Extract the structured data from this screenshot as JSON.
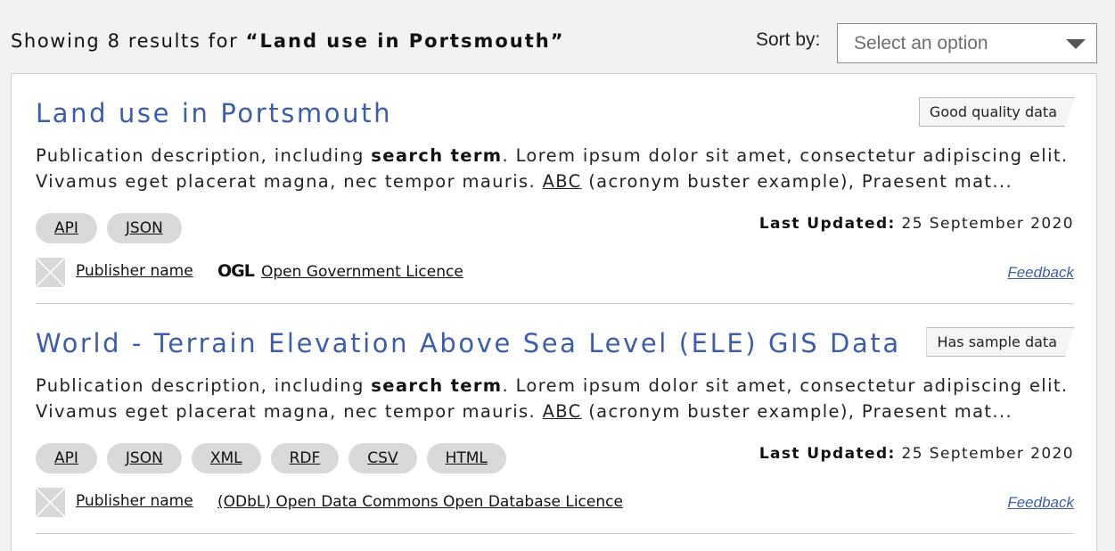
{
  "header": {
    "results_prefix": "Showing 8 results for ",
    "search_term": "“Land use in Portsmouth”",
    "sort_label": "Sort by:",
    "sort_placeholder": "Select an option"
  },
  "results": [
    {
      "title": "Land use in Portsmouth",
      "quality_badge": "Good quality data",
      "desc_part1": "Publication description, including ",
      "desc_bold": "search term",
      "desc_part2": ". Lorem ipsum dolor sit amet, consectetur adipiscing elit. Vivamus eget placerat magna, nec tempor mauris. ",
      "desc_abbr": "ABC",
      "desc_part3": " (acronym buster example), Praesent mat...",
      "formats": [
        "API",
        "JSON"
      ],
      "updated_label": "Last Updated:",
      "updated_value": " 25 September 2020",
      "publisher": "Publisher name",
      "licence_mark": "OGL",
      "licence": "Open Government Licence",
      "feedback": "Feedback"
    },
    {
      "title": "World - Terrain Elevation Above Sea Level (ELE) GIS Data",
      "quality_badge": "Has sample data",
      "desc_part1": "Publication description, including ",
      "desc_bold": "search term",
      "desc_part2": ". Lorem ipsum dolor sit amet, consectetur adipiscing elit. Vivamus eget placerat magna, nec tempor mauris. ",
      "desc_abbr": "ABC",
      "desc_part3": " (acronym buster example), Praesent mat...",
      "formats": [
        "API",
        "JSON",
        "XML",
        "RDF",
        "CSV",
        "HTML"
      ],
      "updated_label": "Last Updated:",
      "updated_value": " 25 September 2020",
      "publisher": "Publisher name",
      "licence": "(ODbL) Open Data Commons Open Database Licence",
      "feedback": "Feedback"
    }
  ],
  "colors": {
    "link_blue": "#3d5da8",
    "tag_gray": "#d9d9d9",
    "page_bg": "#f2f2f2"
  },
  "icons": {
    "publisher_logo": "image-placeholder-icon",
    "sort_caret": "chevron-down-icon"
  }
}
